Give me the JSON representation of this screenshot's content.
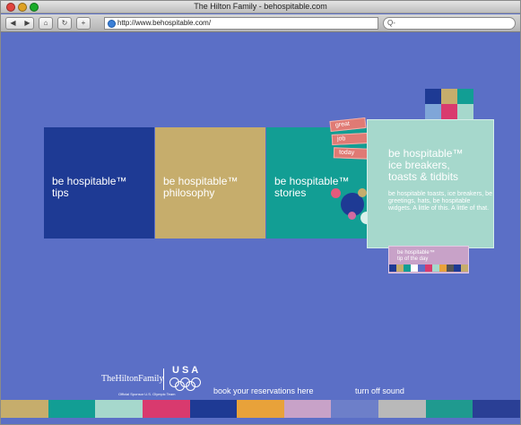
{
  "window": {
    "title": "The Hilton Family - behospitable.com"
  },
  "toolbar": {
    "back_icon": "back-icon",
    "forward_icon": "forward-icon",
    "home_icon": "home-icon",
    "reload_icon": "reload-icon",
    "add_bookmark_icon": "add-bookmark-icon",
    "url": "http://www.behospitable.com/",
    "search_placeholder": "Q-"
  },
  "panels": {
    "tips": {
      "label": "be hospitable™\ntips",
      "color": "#1e3a94"
    },
    "philosophy": {
      "label": "be hospitable™\nphilosophy",
      "color": "#c6ad6c"
    },
    "stories": {
      "label": "be hospitable™\nstories",
      "color": "#129e94"
    },
    "icebreakers": {
      "heading": "be hospitable™\nice breakers,\ntoasts & tidbits",
      "description": "be hospitable toasts, ice breakers, be greetings, hats, be hospitable widgets. A little of this. A little of that.",
      "color": "#a6d8cc"
    }
  },
  "story_tags": [
    "great",
    "job",
    "today"
  ],
  "tip_of_day": {
    "label": "be hospitable™\ntip of the day"
  },
  "footer": {
    "brand": "TheHiltonFamily",
    "usa": "USA",
    "sponsor": "Official Sponsor U.S. Olympic Team",
    "reservations": "book your reservations here",
    "sound": "turn off sound"
  },
  "colors": {
    "background": "#5b6fc6",
    "strip": [
      "#c6ad6c",
      "#129e94",
      "#a6d8cc",
      "#d93a6e",
      "#1e3a94",
      "#e8a23a",
      "#c8a2c8",
      "#6d7fc9",
      "#b9b9b9",
      "#1f9a8f",
      "#2a3f95"
    ]
  }
}
